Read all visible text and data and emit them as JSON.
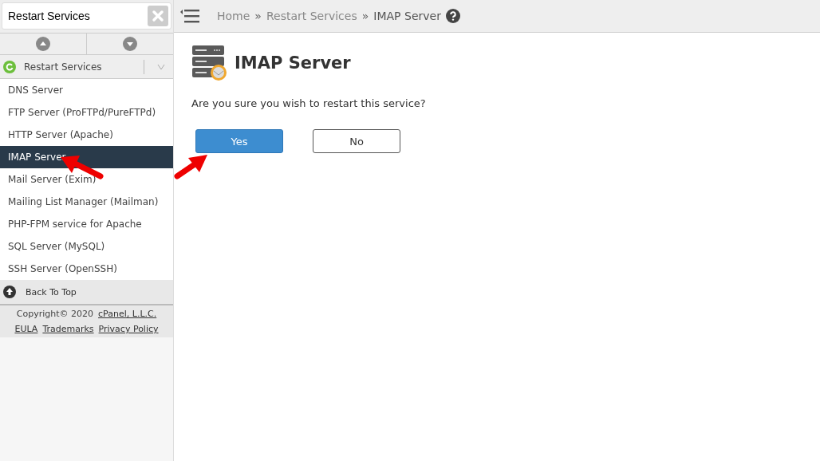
{
  "search": {
    "value": "Restart Services"
  },
  "sidebar": {
    "category": "Restart Services",
    "expanded": false,
    "items": [
      {
        "label": "DNS Server",
        "selected": false
      },
      {
        "label": "FTP Server (ProFTPd/PureFTPd)",
        "selected": false
      },
      {
        "label": "HTTP Server (Apache)",
        "selected": false
      },
      {
        "label": "IMAP Server",
        "selected": true
      },
      {
        "label": "Mail Server (Exim)",
        "selected": false
      },
      {
        "label": "Mailing List Manager (Mailman)",
        "selected": false
      },
      {
        "label": "PHP-FPM service for Apache",
        "selected": false
      },
      {
        "label": "SQL Server (MySQL)",
        "selected": false
      },
      {
        "label": "SSH Server (OpenSSH)",
        "selected": false
      }
    ],
    "back_to_top": "Back To Top",
    "copyright": "Copyright© 2020",
    "company_link": "cPanel, L.L.C.",
    "footer_links": [
      "EULA",
      "Trademarks",
      "Privacy Policy"
    ]
  },
  "breadcrumb": [
    {
      "label": "Home",
      "sep": "»"
    },
    {
      "label": "Restart Services",
      "sep": "»"
    },
    {
      "label": "IMAP Server"
    }
  ],
  "title": "IMAP Server",
  "question": "Are you sure you wish to restart this service?",
  "buttons": [
    {
      "label": "Yes",
      "kind": "primary"
    },
    {
      "label": "No",
      "kind": "secondary"
    }
  ]
}
